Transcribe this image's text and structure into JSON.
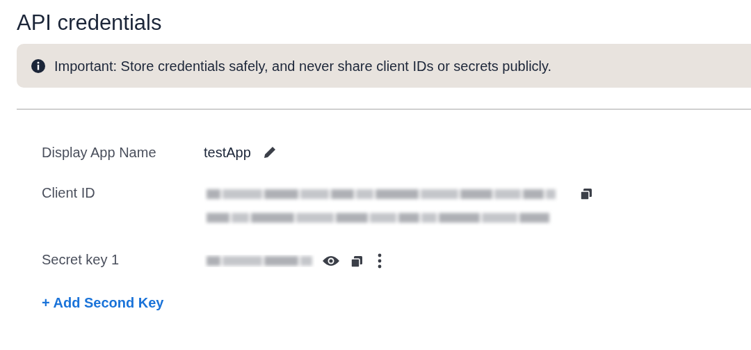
{
  "title": "API credentials",
  "alert": {
    "text": "Important: Store credentials safely, and never share client IDs or secrets publicly."
  },
  "fields": [
    {
      "label": "Display App Name",
      "kind": "editable",
      "value": "testApp"
    },
    {
      "label": "Client ID",
      "kind": "copyable"
    },
    {
      "label": "Secret key 1",
      "kind": "secret"
    }
  ],
  "add_link": "+ Add Second Key"
}
